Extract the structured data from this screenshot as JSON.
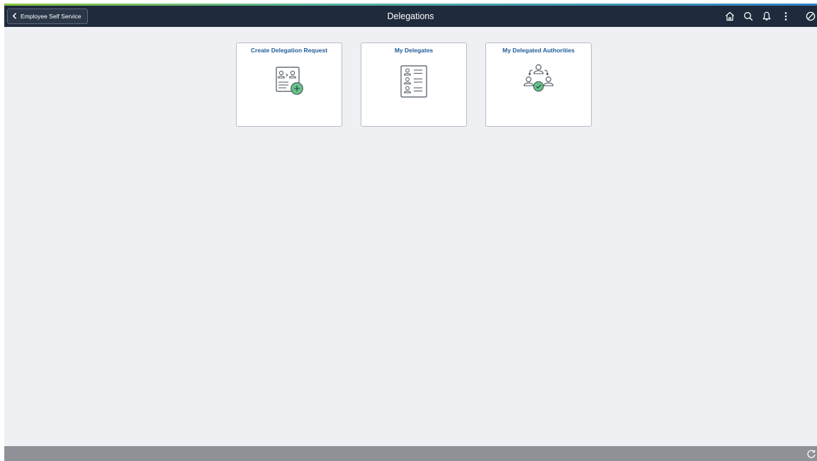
{
  "header": {
    "back_label": "Employee Self Service",
    "title": "Delegations",
    "icons": [
      "home-icon",
      "search-icon",
      "bell-icon",
      "more-vertical-icon",
      "no-entry-icon"
    ]
  },
  "tiles": [
    {
      "title": "Create Delegation Request",
      "icon": "delegation-request-icon"
    },
    {
      "title": "My Delegates",
      "icon": "delegates-list-icon"
    },
    {
      "title": "My Delegated Authorities",
      "icon": "delegated-authorities-icon"
    }
  ],
  "footer": {
    "icon": "refresh-icon"
  },
  "colors": {
    "header_bg": "#1f2b3c",
    "page_bg": "#eff0f4",
    "tile_title": "#215c99",
    "accent_green": "#8cc63f",
    "footer_bg": "#8e9297"
  }
}
